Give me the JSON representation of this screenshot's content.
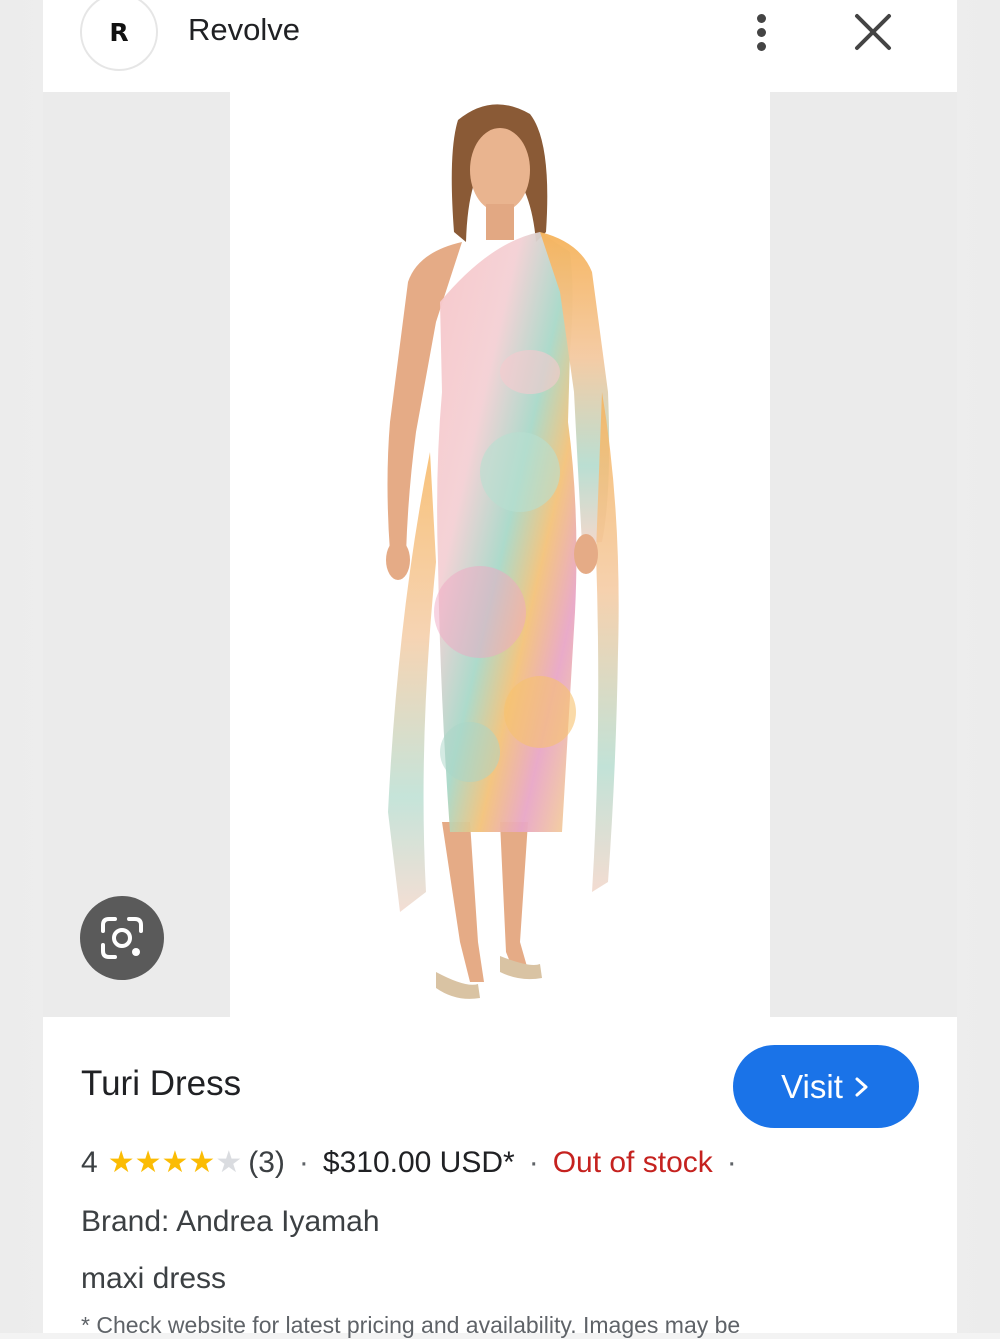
{
  "header": {
    "logo_letter": "R",
    "site_name": "Revolve"
  },
  "product": {
    "title": "Turi Dress",
    "visit_label": "Visit",
    "rating_value": "4",
    "rating_stars": 4,
    "rating_max": 5,
    "review_count": "(3)",
    "separator": "·",
    "price": "$310.00 USD*",
    "stock_status": "Out of stock",
    "brand": "Brand: Andrea Iyamah",
    "category": "maxi dress",
    "disclaimer": "* Check website for latest pricing and availability. Images may be"
  },
  "icons": {
    "more": "more-vert-icon",
    "close": "close-icon",
    "lens": "google-lens-icon",
    "visit_arrow": "chevron-right-icon",
    "star": "star-icon"
  },
  "colors": {
    "visit_button": "#1a73e8",
    "out_of_stock": "#c5221f",
    "star_filled": "#fbbc04",
    "star_empty": "#dadce0"
  }
}
